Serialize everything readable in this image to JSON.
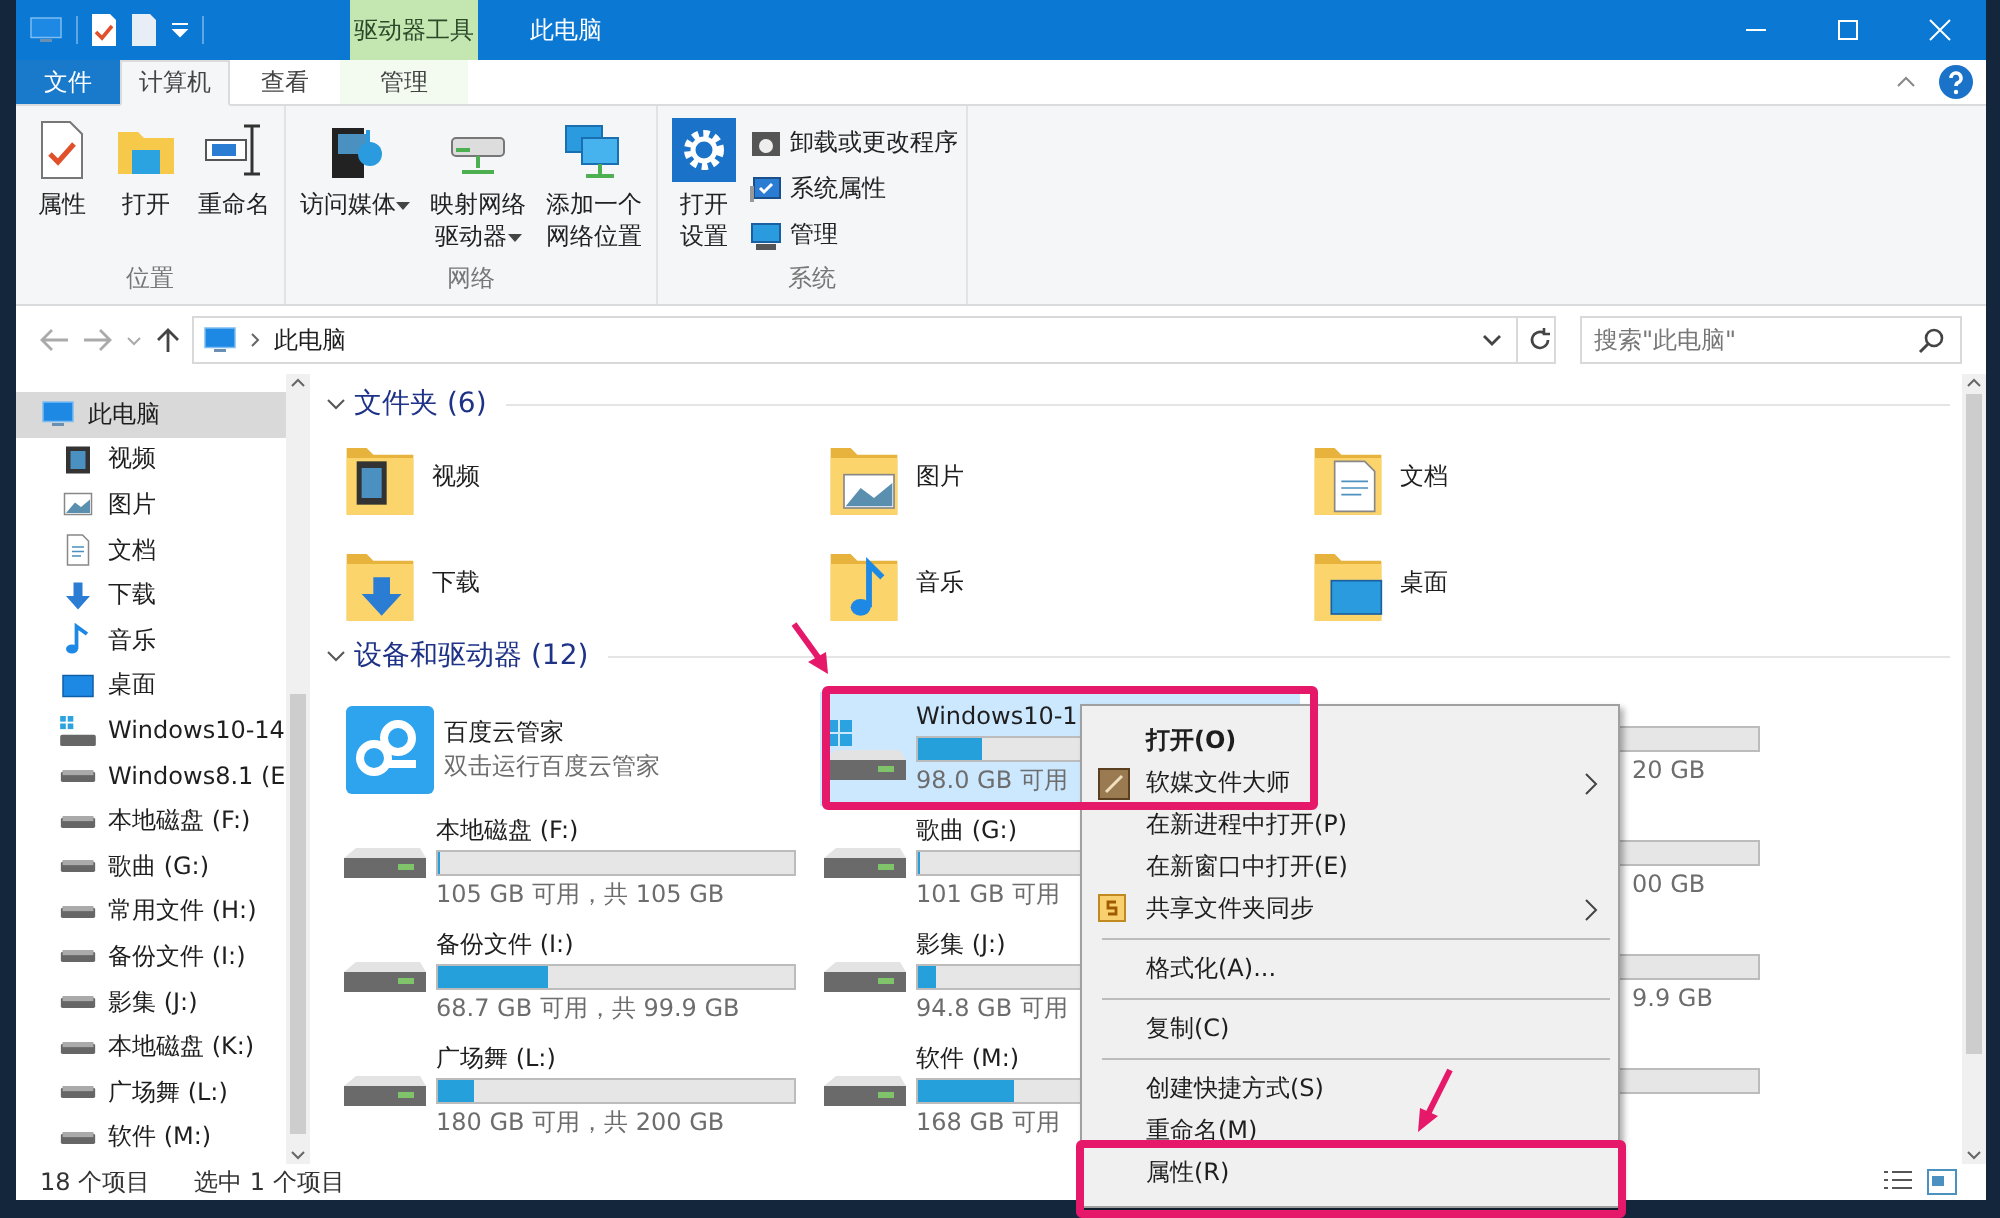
{
  "window": {
    "title": "此电脑",
    "context_tab": "驱动器工具"
  },
  "ribbon_tabs": [
    {
      "label": "文件",
      "kind": "file",
      "selected": false
    },
    {
      "label": "计算机",
      "kind": "normal",
      "selected": true
    },
    {
      "label": "查看",
      "kind": "normal",
      "selected": false
    },
    {
      "label": "管理",
      "kind": "context",
      "selected": false
    }
  ],
  "ribbon_groups": [
    {
      "label": "位置",
      "buttons": [
        {
          "lines": [
            "属性"
          ]
        },
        {
          "lines": [
            "打开"
          ]
        },
        {
          "lines": [
            "重命名"
          ]
        }
      ]
    },
    {
      "label": "网络",
      "buttons": [
        {
          "lines": [
            "访问媒体"
          ],
          "dropdown": true
        },
        {
          "lines": [
            "映射网络",
            "驱动器"
          ],
          "dropdown": true
        },
        {
          "lines": [
            "添加一个",
            "网络位置"
          ]
        }
      ]
    },
    {
      "label": "系统",
      "buttons": [
        {
          "lines": [
            "打开",
            "设置"
          ]
        }
      ],
      "small_buttons": [
        {
          "label": "卸载或更改程序"
        },
        {
          "label": "系统属性"
        },
        {
          "label": "管理"
        }
      ]
    }
  ],
  "address_bar": {
    "location": "此电脑",
    "search_placeholder": "搜索\"此电脑\""
  },
  "sidebar": {
    "items": [
      {
        "label": "此电脑",
        "kind": "pc",
        "selected": true,
        "children": [
          {
            "label": "视频",
            "kind": "video",
            "selected": false
          },
          {
            "label": "图片",
            "kind": "pictures",
            "selected": false
          },
          {
            "label": "文档",
            "kind": "docs",
            "selected": false
          },
          {
            "label": "下载",
            "kind": "downloads",
            "selected": false
          },
          {
            "label": "音乐",
            "kind": "music",
            "selected": false
          },
          {
            "label": "桌面",
            "kind": "desktop",
            "selected": false
          },
          {
            "label": "Windows10-14",
            "kind": "windrive",
            "selected": false
          },
          {
            "label": "Windows8.1 (E",
            "kind": "drive",
            "selected": false
          },
          {
            "label": "本地磁盘 (F:)",
            "kind": "drive",
            "selected": false
          },
          {
            "label": "歌曲 (G:)",
            "kind": "drive",
            "selected": false
          },
          {
            "label": "常用文件 (H:)",
            "kind": "drive",
            "selected": false
          },
          {
            "label": "备份文件  (I:)",
            "kind": "drive",
            "selected": false
          },
          {
            "label": "影集 (J:)",
            "kind": "drive",
            "selected": false
          },
          {
            "label": "本地磁盘 (K:)",
            "kind": "drive",
            "selected": false
          },
          {
            "label": "广场舞 (L:)",
            "kind": "drive",
            "selected": false
          },
          {
            "label": "软件 (M:)",
            "kind": "drive",
            "selected": false
          }
        ]
      }
    ]
  },
  "content": {
    "sections": [
      {
        "title": "文件夹 (6)",
        "expanded": true,
        "kind": "folders",
        "items": [
          {
            "label": "视频",
            "kind": "video"
          },
          {
            "label": "图片",
            "kind": "pictures"
          },
          {
            "label": "文档",
            "kind": "docs"
          },
          {
            "label": "下载",
            "kind": "downloads"
          },
          {
            "label": "音乐",
            "kind": "music"
          },
          {
            "label": "桌面",
            "kind": "desktop"
          }
        ]
      },
      {
        "title": "设备和驱动器 (12)",
        "expanded": true,
        "kind": "drives",
        "items": [
          {
            "kind": "app",
            "name": "百度云管家",
            "detail": "双击运行百度云管家"
          },
          {
            "kind": "system_drive",
            "name": "Windows10-1",
            "level": 0.18,
            "detail": "98.0 GB 可用",
            "selected": true
          },
          {
            "kind": "partial",
            "detail": "20 GB"
          },
          {
            "kind": "drive",
            "name": "本地磁盘 (F:)",
            "level": 0,
            "detail": "105 GB 可用，共 105 GB"
          },
          {
            "kind": "drive",
            "name": "歌曲 (G:)",
            "level": 0,
            "detail": "101 GB 可用"
          },
          {
            "kind": "partial",
            "detail": "00 GB"
          },
          {
            "kind": "drive",
            "name": "备份文件  (I:)",
            "level": 0.31,
            "detail": "68.7 GB 可用，共 99.9 GB"
          },
          {
            "kind": "drive",
            "name": "影集 (J:)",
            "level": 0.05,
            "detail": "94.8 GB 可用"
          },
          {
            "kind": "partial",
            "detail": "9.9 GB"
          },
          {
            "kind": "drive",
            "name": "广场舞 (L:)",
            "level": 0.1,
            "detail": "180 GB 可用，共 200 GB"
          },
          {
            "kind": "drive",
            "name": "软件 (M:)",
            "level": 0.27,
            "detail": "168 GB 可用"
          },
          {
            "kind": "partial"
          }
        ]
      }
    ]
  },
  "context_menu": {
    "items": [
      {
        "kind": "item",
        "label": "打开(O)",
        "bold": true
      },
      {
        "kind": "app",
        "label": "软媒文件大师",
        "submenu": true
      },
      {
        "kind": "item",
        "label": "在新进程中打开(P)"
      },
      {
        "kind": "item",
        "label": "在新窗口中打开(E)"
      },
      {
        "kind": "sync",
        "label": "共享文件夹同步",
        "submenu": true
      },
      {
        "kind": "separator"
      },
      {
        "kind": "item",
        "label": "格式化(A)..."
      },
      {
        "kind": "separator"
      },
      {
        "kind": "item",
        "label": "复制(C)"
      },
      {
        "kind": "separator"
      },
      {
        "kind": "item",
        "label": "创建快捷方式(S)"
      },
      {
        "kind": "item",
        "label": "重命名(M)"
      },
      {
        "kind": "item",
        "label": "属性(R)"
      }
    ]
  },
  "status_bar": {
    "items": "18 个项目",
    "selection": "选中 1 个项目"
  }
}
